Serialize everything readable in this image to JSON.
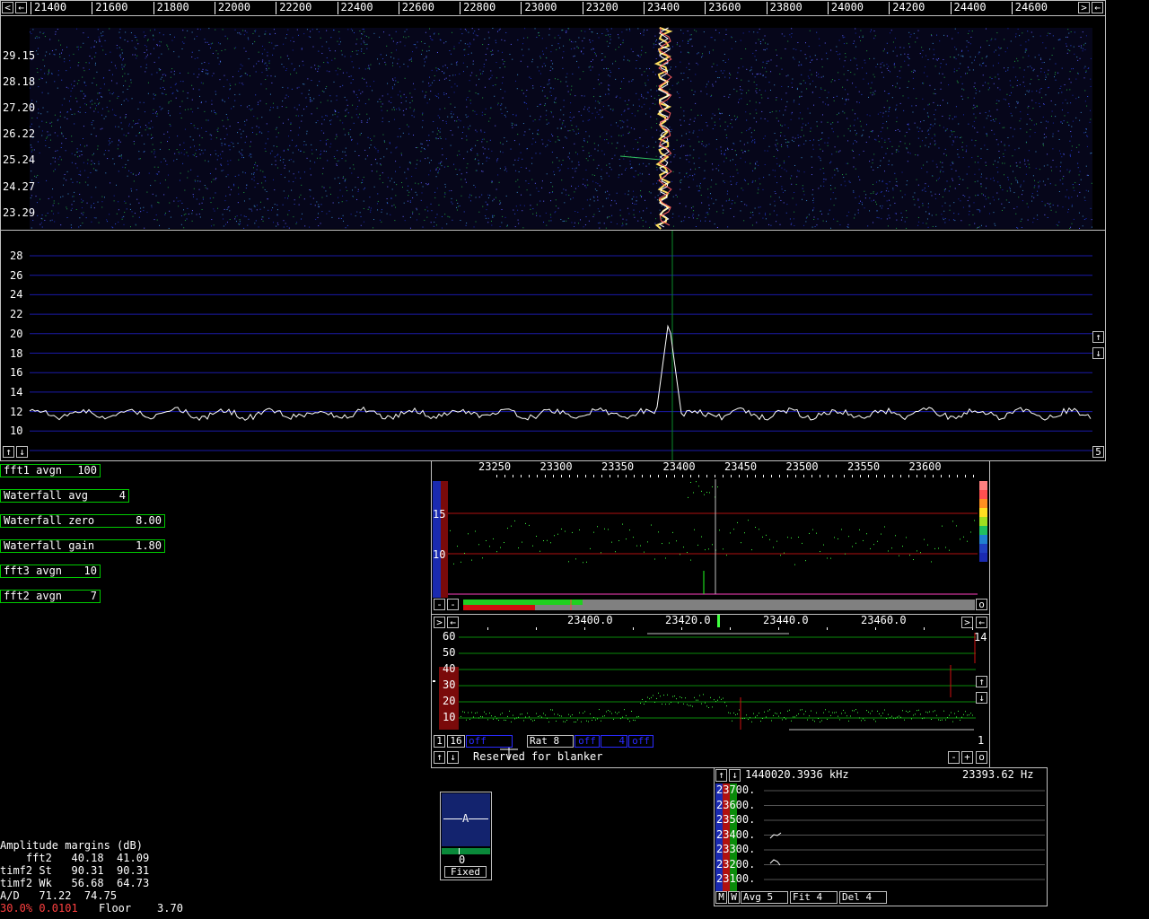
{
  "main_scale": {
    "ticks": [
      "21400",
      "21600",
      "21800",
      "22000",
      "22200",
      "22400",
      "22600",
      "22800",
      "23000",
      "23200",
      "23400",
      "23600",
      "23800",
      "24000",
      "24200",
      "24400",
      "24600"
    ]
  },
  "waterfall": {
    "time_labels": [
      "29.15",
      "28.18",
      "27.20",
      "26.22",
      "25.24",
      "24.27",
      "23.29"
    ]
  },
  "spectrum": {
    "y_labels": [
      "28",
      "26",
      "24",
      "22",
      "20",
      "18",
      "16",
      "14",
      "12",
      "10"
    ],
    "corner_value": "5"
  },
  "params": [
    {
      "label": "fft1 avgn",
      "value": "100"
    },
    {
      "label": "Waterfall avg",
      "value": "4"
    },
    {
      "label": "Waterfall zero",
      "value": "8.00"
    },
    {
      "label": "Waterfall gain",
      "value": "1.80"
    },
    {
      "label": "fft3 avgn",
      "value": "10"
    },
    {
      "label": "fft2 avgn",
      "value": "7"
    }
  ],
  "baseband": {
    "ticks": [
      "23250",
      "23300",
      "23350",
      "23400",
      "23450",
      "23500",
      "23550",
      "23600"
    ],
    "y_labels": [
      "15",
      "10"
    ],
    "o_button": "o"
  },
  "highres": {
    "ticks": [
      "23400.0",
      "23420.0",
      "23440.0",
      "23460.0"
    ],
    "y_labels": [
      "60",
      "50",
      "40",
      "30",
      "20",
      "10"
    ],
    "right_value": "14",
    "bottom_right_value": "1",
    "controls": [
      "1",
      "16",
      "off",
      "Rat  8",
      "off",
      "4",
      "off"
    ],
    "blanker_text": "Reserved for blanker",
    "minus_label": "-",
    "plus_label": "+",
    "o_label": "o"
  },
  "agc": {
    "letter": "A",
    "value": "0",
    "mode": "Fixed"
  },
  "freq_panel": {
    "frequency": "1440020.3936 kHz",
    "hz_value": "23393.62 Hz",
    "y_labels": [
      "23700.",
      "23600.",
      "23500.",
      "23400.",
      "23300.",
      "23200.",
      "23100."
    ],
    "buttons": [
      "M",
      "W",
      "Avg  5",
      "Fit  4",
      "Del  4"
    ]
  },
  "margins": {
    "title": "Amplitude margins (dB)",
    "rows": [
      "    fft2   40.18  41.09",
      "timf2 St   90.31  90.31",
      "timf2 Wk   56.68  64.73",
      "A/D   71.22  74.75"
    ],
    "status_red": "30.0% 0.0101",
    "floor": "Floor    3.70"
  },
  "colors": {
    "grid_blue": "#1a1aa8",
    "grid_red": "#b01010",
    "grid_green": "#0a8a0a",
    "trace_green": "#40ff40",
    "panel_border": "#c0c0c0"
  }
}
